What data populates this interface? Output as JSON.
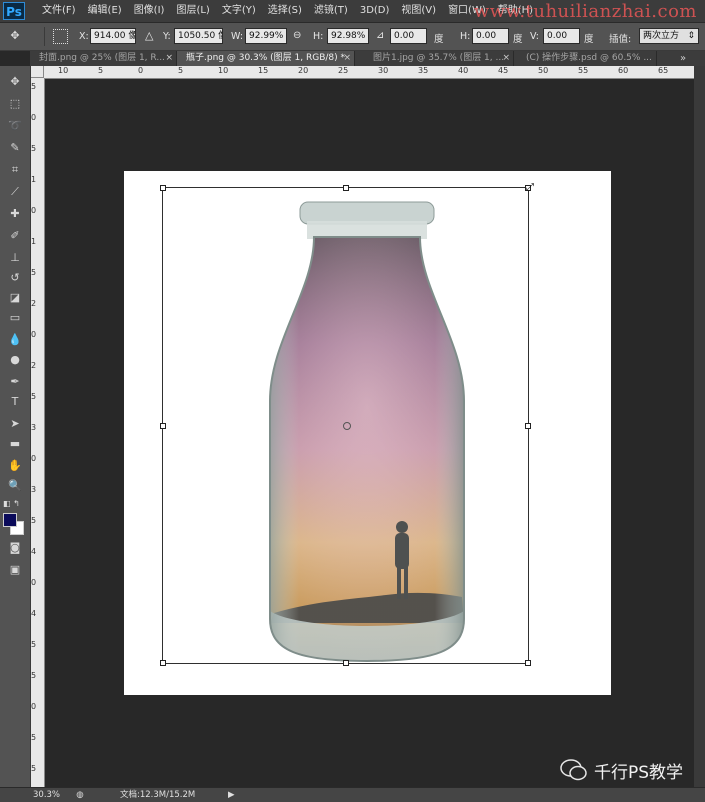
{
  "app": {
    "logo": "Ps"
  },
  "menubar": {
    "items": [
      "文件(F)",
      "编辑(E)",
      "图像(I)",
      "图层(L)",
      "文字(Y)",
      "选择(S)",
      "滤镜(T)",
      "3D(D)",
      "视图(V)",
      "窗口(W)",
      "帮助(H)"
    ],
    "watermark": "www.tuhuilianzhai.com"
  },
  "options": {
    "x_label": "X:",
    "x_value": "914.00 像",
    "y_label": "Y:",
    "y_value": "1050.50 像",
    "w_label": "W:",
    "w_value": "92.99%",
    "link_icon": "link-icon",
    "h_label": "H:",
    "h_value": "92.98%",
    "angle_value": "0.00",
    "angle_unit": "度",
    "hskew_label": "H:",
    "hskew_value": "0.00",
    "hskew_unit": "度",
    "vskew_label": "V:",
    "vskew_value": "0.00",
    "vskew_unit": "度",
    "interp_label": "插值:",
    "interp_value": "两次立方"
  },
  "tabs": [
    {
      "label": "封面.png @ 25% (图层 1, R...",
      "active": false
    },
    {
      "label": "瓶子.png @ 30.3% (图层 1, RGB/8) *",
      "active": true
    },
    {
      "label": "图片1.jpg @ 35.7% (图层 1, ...",
      "active": false
    },
    {
      "label": "(C) 操作步骤.psd @ 60.5% ...",
      "active": false
    }
  ],
  "ruler": {
    "h_ticks": [
      "10",
      "5",
      "0",
      "5",
      "10",
      "15",
      "20",
      "25",
      "30",
      "35",
      "40",
      "45",
      "50",
      "55",
      "60",
      "65"
    ],
    "v_ticks": [
      "5",
      "0",
      "5",
      "1",
      "0",
      "1",
      "5",
      "2",
      "0",
      "2",
      "5",
      "3",
      "0",
      "3",
      "5",
      "4",
      "0",
      "4",
      "5",
      "5",
      "0",
      "5",
      "5"
    ]
  },
  "status": {
    "zoom": "30.3%",
    "doc_info": "文档:12.3M/15.2M"
  },
  "brand": {
    "text": "千行PS教学",
    "icon": "wechat-icon"
  },
  "colors": {
    "foreground": "#0a0a5a",
    "background": "#ffffff",
    "accent": "#31a8ff"
  }
}
